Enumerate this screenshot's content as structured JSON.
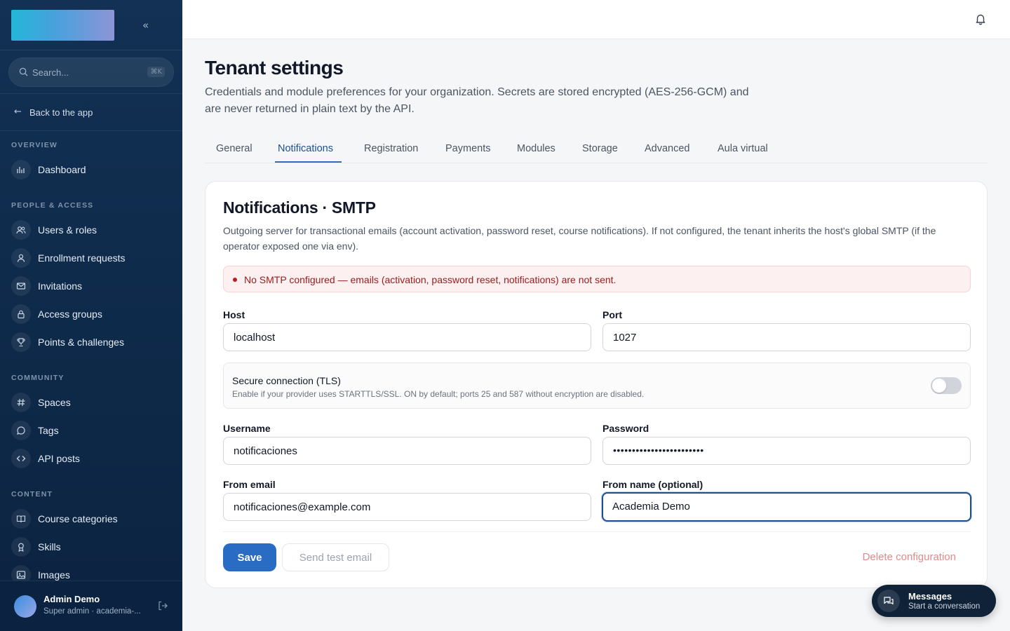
{
  "sidebar": {
    "collapse_glyph": "«",
    "search": {
      "placeholder": "Search...",
      "shortcut": "⌘K"
    },
    "back_label": "Back to the app",
    "sections": {
      "overview": "OVERVIEW",
      "people": "PEOPLE & ACCESS",
      "community": "COMMUNITY",
      "content": "CONTENT"
    },
    "items": [
      {
        "label": "Dashboard",
        "icon": "bar-chart-icon"
      },
      {
        "label": "Users & roles",
        "icon": "users-icon"
      },
      {
        "label": "Enrollment requests",
        "icon": "user-icon"
      },
      {
        "label": "Invitations",
        "icon": "mail-icon"
      },
      {
        "label": "Access groups",
        "icon": "lock-icon"
      },
      {
        "label": "Points & challenges",
        "icon": "trophy-icon"
      },
      {
        "label": "Spaces",
        "icon": "hash-icon"
      },
      {
        "label": "Tags",
        "icon": "chat-bubble-icon"
      },
      {
        "label": "API posts",
        "icon": "code-icon"
      },
      {
        "label": "Course categories",
        "icon": "book-icon"
      },
      {
        "label": "Skills",
        "icon": "award-icon"
      },
      {
        "label": "Images",
        "icon": "image-icon"
      }
    ],
    "user": {
      "name": "Admin Demo",
      "role": "Super admin · academia-..."
    }
  },
  "page": {
    "title": "Tenant settings",
    "description": "Credentials and module preferences for your organization. Secrets are stored encrypted (AES-256-GCM) and are never returned in plain text by the API.",
    "tabs": [
      "General",
      "Notifications",
      "Registration",
      "Payments",
      "Modules",
      "Storage",
      "Advanced",
      "Aula virtual"
    ],
    "active_tab": "Notifications"
  },
  "card": {
    "title": "Notifications · SMTP",
    "description": "Outgoing server for transactional emails (account activation, password reset, course notifications). If not configured, the tenant inherits the host's global SMTP (if the operator exposed one via env).",
    "alert": "No SMTP configured — emails (activation, password reset, notifications) are not sent.",
    "fields": {
      "host": {
        "label": "Host",
        "value": "localhost"
      },
      "port": {
        "label": "Port",
        "value": "1027"
      },
      "username": {
        "label": "Username",
        "value": "notificaciones"
      },
      "password": {
        "label": "Password",
        "value": "••••••••••••••••••••••••"
      },
      "from_email": {
        "label": "From email",
        "value": "notificaciones@example.com"
      },
      "from_name": {
        "label": "From name (optional)",
        "value": "Academia Demo"
      }
    },
    "tls": {
      "title": "Secure connection (TLS)",
      "help": "Enable if your provider uses STARTTLS/SSL. ON by default; ports 25 and 587 without encryption are disabled.",
      "enabled": false
    },
    "buttons": {
      "save": "Save",
      "test": "Send test email",
      "delete": "Delete configuration"
    }
  },
  "messages": {
    "title": "Messages",
    "subtitle": "Start a conversation"
  },
  "colors": {
    "accent": "#2a6cc3",
    "sidebar": "#0b2340",
    "alert_bg": "#fdf0f0",
    "alert_text": "#991b1b"
  }
}
